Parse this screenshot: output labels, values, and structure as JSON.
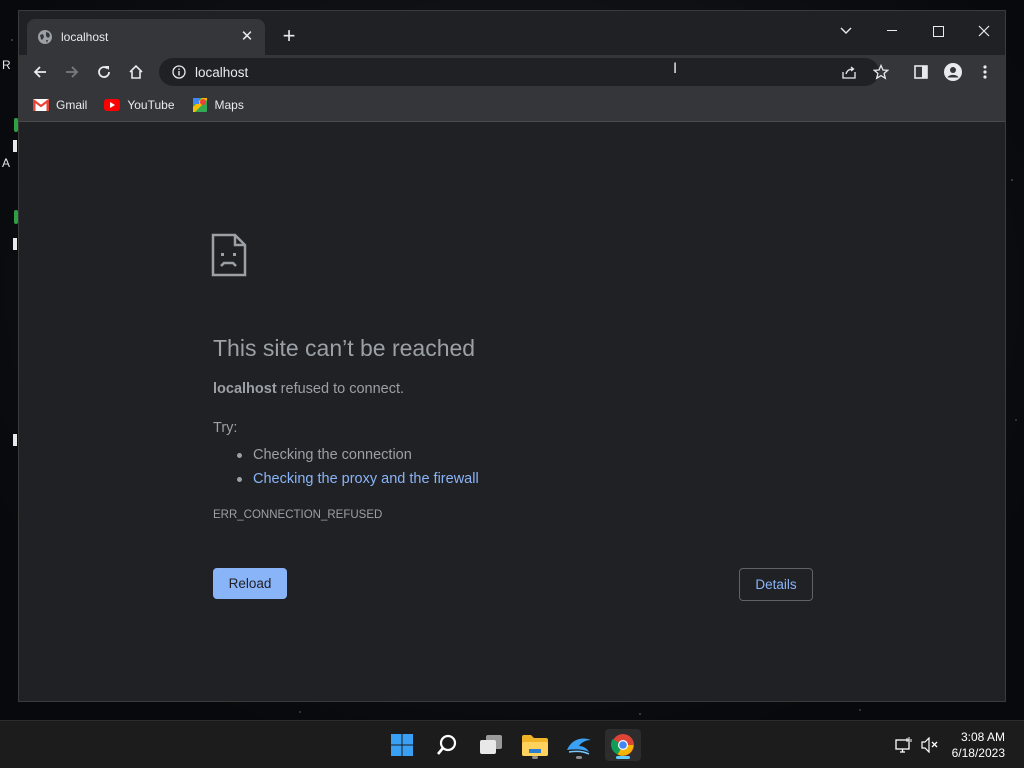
{
  "desktop": {
    "glyphs": [
      "R",
      "A",
      "I",
      "I",
      "I"
    ]
  },
  "browser": {
    "tab": {
      "title": "localhost",
      "close_glyph": "✕",
      "icon": "globe-icon"
    },
    "new_tab_glyph": "+",
    "address_bar": {
      "url": "localhost",
      "icon": "info-icon"
    },
    "bookmarks": [
      {
        "label": "Gmail",
        "icon": "gmail-icon"
      },
      {
        "label": "YouTube",
        "icon": "youtube-icon"
      },
      {
        "label": "Maps",
        "icon": "maps-icon"
      }
    ]
  },
  "error_page": {
    "title": "This site can’t be reached",
    "summary_host": "localhost",
    "summary_rest": " refused to connect.",
    "try_label": "Try:",
    "suggestions": [
      "Checking the connection",
      "Checking the proxy and the firewall"
    ],
    "error_code": "ERR_CONNECTION_REFUSED",
    "reload_label": "Reload",
    "details_label": "Details"
  },
  "taskbar": {
    "apps": [
      "start",
      "search",
      "task-view",
      "file-explorer",
      "dolphin",
      "chrome"
    ],
    "clock_time": "3:08 AM",
    "clock_date": "6/18/2023"
  },
  "colors": {
    "page_bg": "#202124",
    "toolbar_bg": "#35363a",
    "link": "#8ab4f8",
    "text_muted": "#9aa0a6"
  }
}
